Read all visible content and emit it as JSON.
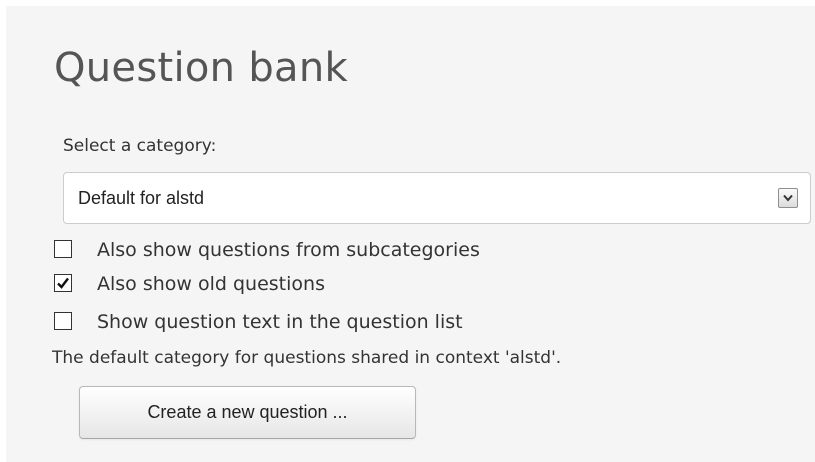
{
  "page": {
    "title": "Question bank"
  },
  "category": {
    "label": "Select a category:",
    "selected": "Default for alstd"
  },
  "options": [
    {
      "label": "Also show questions from subcategories",
      "checked": false
    },
    {
      "label": "Also show old questions",
      "checked": true
    },
    {
      "label": "Show question text in the question list",
      "checked": false
    }
  ],
  "info_text": "The default category for questions shared in context 'alstd'.",
  "create_button": {
    "label": "Create a new question ..."
  },
  "icons": {
    "select_arrow": "chevron-down-icon",
    "checkmark": "checkmark-icon"
  },
  "colors": {
    "panel_background": "#f5f5f5",
    "title_text": "#555555",
    "body_text": "#333333"
  }
}
